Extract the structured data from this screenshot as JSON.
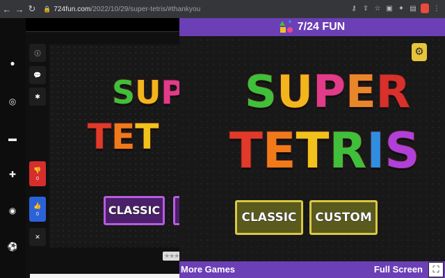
{
  "browser": {
    "url_domain": "724fun.com",
    "url_path": "/2022/10/29/super-tetris/#thankyou",
    "back_icon": "arrow-left-icon",
    "forward_icon": "arrow-right-icon",
    "reload_icon": "reload-icon"
  },
  "site_sidebar": {
    "icons": [
      "bomb-icon",
      "gamepad-icon",
      "car-icon",
      "puzzle-icon",
      "target-icon",
      "soccer-ball-icon"
    ]
  },
  "actions": {
    "info_icon": "info-icon",
    "comment_icon": "comment-icon",
    "bug_icon": "bug-icon",
    "dislike_count": "0",
    "like_count": "0",
    "fullscreen_icon": "expand-icon"
  },
  "game": {
    "brand": "7/24 FUN",
    "title_line1": [
      "S",
      "U",
      "P",
      "E",
      "R"
    ],
    "title_line2": [
      "T",
      "E",
      "T",
      "R",
      "I",
      "S"
    ],
    "title_colors_line1": [
      "#3fbf3a",
      "#f2b51c",
      "#e23b8a",
      "#e8862a",
      "#d9302c"
    ],
    "title_colors_line2": [
      "#e23a2a",
      "#f07a1a",
      "#f2c21c",
      "#3fbf3a",
      "#2f8ee0",
      "#b040d8"
    ],
    "classic_label": "CLASSIC",
    "custom_label": "CUSTOM",
    "more_games": "More Games",
    "full_screen": "Full Screen",
    "settings_icon": "gear-icon",
    "fullscreen_toggle_icon": "fullscreen-icon"
  },
  "underlay": {
    "title_line1": [
      "S",
      "U",
      "P"
    ],
    "title_line2": [
      "T",
      "E",
      "T"
    ],
    "classic_label": "CLASSIC",
    "rating": "★★★★"
  }
}
